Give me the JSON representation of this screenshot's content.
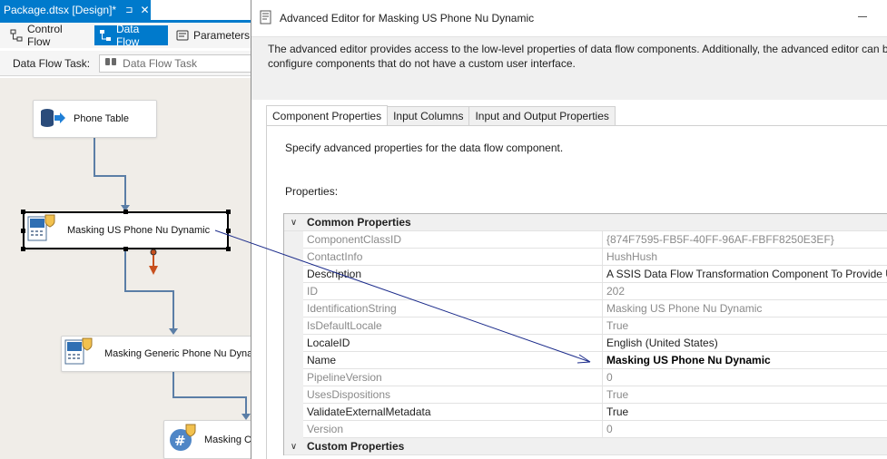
{
  "designer": {
    "doc_tab": {
      "label": "Package.dtsx [Design]*",
      "pin": "⊐",
      "close": "✕"
    },
    "tabs": [
      {
        "label": "Control Flow",
        "icon": "control-flow-icon"
      },
      {
        "label": "Data Flow",
        "icon": "data-flow-icon"
      },
      {
        "label": "Parameters",
        "icon": "parameters-icon"
      }
    ],
    "task_label": "Data Flow Task:",
    "task_value": "Data Flow Task",
    "components": {
      "phone_table": "Phone Table",
      "masking_us": "Masking US Phone Nu Dynamic",
      "masking_generic": "Masking Generic Phone Nu Dynam",
      "masking_third": "Masking C"
    }
  },
  "dialog": {
    "title": "Advanced Editor for Masking US Phone Nu Dynamic",
    "intro_line1": "The advanced editor provides access to the low-level properties of data flow components. Additionally, the advanced editor can b",
    "intro_line2": "configure components that do not have a custom user interface.",
    "tabs": [
      "Component Properties",
      "Input Columns",
      "Input and Output Properties"
    ],
    "panel_hint": "Specify advanced properties for the data flow component.",
    "properties_label": "Properties:",
    "categories": {
      "common": {
        "label": "Common Properties",
        "toggle": "∨"
      },
      "custom": {
        "label": "Custom Properties",
        "toggle": "∨"
      }
    },
    "properties": [
      {
        "name": "ComponentClassID",
        "value": "{874F7595-FB5F-40FF-96AF-FBFF8250E3EF}",
        "readonly": true
      },
      {
        "name": "ContactInfo",
        "value": "HushHush",
        "readonly": true
      },
      {
        "name": "Description",
        "value": "A SSIS Data Flow Transformation Component To Provide US",
        "readonly": false
      },
      {
        "name": "ID",
        "value": "202",
        "readonly": true
      },
      {
        "name": "IdentificationString",
        "value": "Masking US Phone Nu Dynamic",
        "readonly": true
      },
      {
        "name": "IsDefaultLocale",
        "value": "True",
        "readonly": true
      },
      {
        "name": "LocaleID",
        "value": "English (United States)",
        "readonly": false
      },
      {
        "name": "Name",
        "value": "Masking US Phone Nu Dynamic",
        "readonly": false,
        "bold": true
      },
      {
        "name": "PipelineVersion",
        "value": "0",
        "readonly": true
      },
      {
        "name": "UsesDispositions",
        "value": "True",
        "readonly": true
      },
      {
        "name": "ValidateExternalMetadata",
        "value": "True",
        "readonly": false
      },
      {
        "name": "Version",
        "value": "0",
        "readonly": true
      }
    ]
  },
  "colors": {
    "accent": "#007acc",
    "annotation_arrow": "#1a2a8a",
    "error_path": "#c8501e",
    "data_path": "#5b7ea6"
  }
}
